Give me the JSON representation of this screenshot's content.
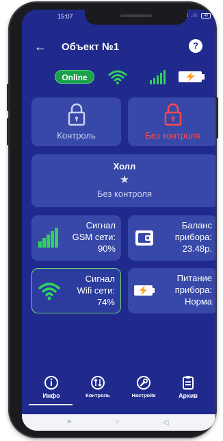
{
  "status_bar": {
    "time": "15:07",
    "signal_text": "Sil .ıl",
    "battery_text": "40"
  },
  "header": {
    "back_symbol": "←",
    "title": "Объект №1",
    "help_symbol": "?"
  },
  "indicators": {
    "online_label": "Online"
  },
  "controls": {
    "armed_label": "Контроль",
    "disarmed_label": "Без контроля"
  },
  "zone": {
    "name": "Холл",
    "star": "★",
    "state": "Без контроля"
  },
  "tiles": {
    "gsm": {
      "line1": "Сигнал",
      "line2": "GSM сети:",
      "value": "90%"
    },
    "balance": {
      "line1": "Баланс",
      "line2": "прибора:",
      "value": "23.48р."
    },
    "wifi": {
      "line1": "Сигнал",
      "line2": "Wifi сети:",
      "value": "74%"
    },
    "power": {
      "line1": "Питание",
      "line2": "прибора:",
      "value": "Норма"
    }
  },
  "nav": {
    "info": "Инфо",
    "control": "Контроль",
    "settings": "Настройк",
    "archive": "Архив"
  },
  "system_nav": {
    "menu": "≡",
    "home": "○",
    "back": "◁"
  },
  "colors": {
    "background": "#1f2a8c",
    "card": "#3748a8",
    "online_green": "#19a24a",
    "alert_red": "#ff4a4a",
    "wifi_green": "#2fd15f",
    "battery_orange": "#ff9c1a"
  },
  "icons": {
    "back": "arrow-left-icon",
    "help": "question-circle-icon",
    "wifi": "wifi-icon",
    "gsm": "signal-bars-icon",
    "battery": "battery-charging-icon",
    "lock": "lock-icon",
    "wallet": "wallet-icon",
    "info": "info-icon",
    "control": "arrows-cycle-icon",
    "settings": "wrench-icon",
    "archive": "archive-list-icon"
  }
}
